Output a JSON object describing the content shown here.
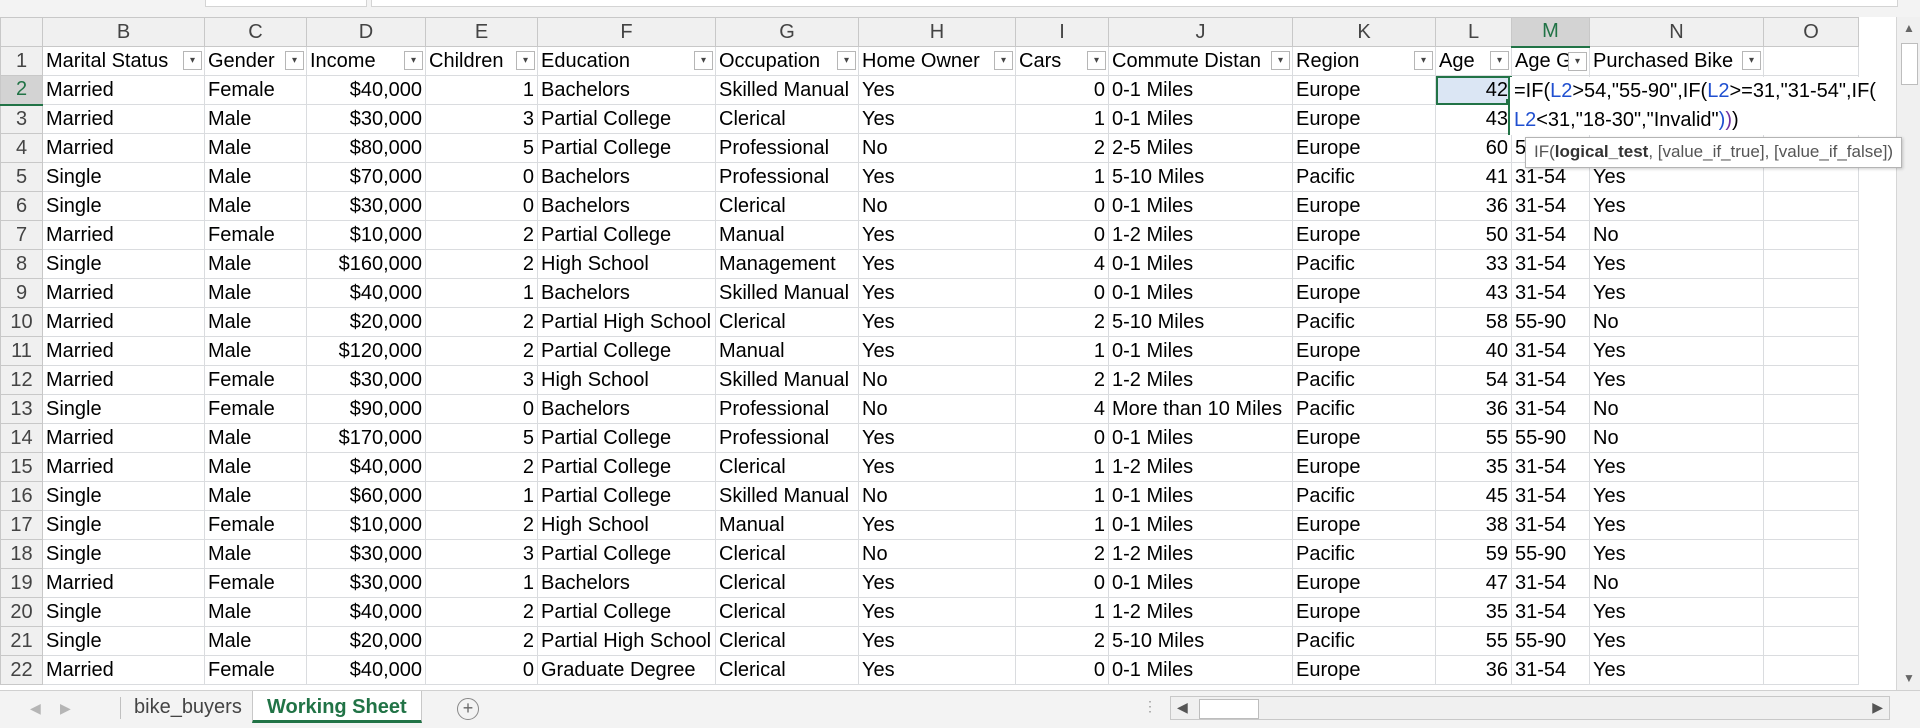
{
  "sheet": {
    "column_letters": [
      "B",
      "C",
      "D",
      "E",
      "F",
      "G",
      "H",
      "I",
      "J",
      "K",
      "L",
      "M",
      "N",
      "O"
    ],
    "headers": [
      "Marital Status",
      "Gender",
      "Income",
      "Children",
      "Education",
      "Occupation",
      "Home Owner",
      "Cars",
      "Commute Distan",
      "Region",
      "Age",
      "Age G",
      "Purchased Bike",
      ""
    ],
    "rows": [
      {
        "n": "1"
      },
      {
        "n": "2",
        "c": [
          "Married",
          "Female",
          "$40,000",
          "1",
          "Bachelors",
          "Skilled Manual",
          "Yes",
          "0",
          "0-1 Miles",
          "Europe",
          "42",
          "",
          ""
        ]
      },
      {
        "n": "3",
        "c": [
          "Married",
          "Male",
          "$30,000",
          "3",
          "Partial College",
          "Clerical",
          "Yes",
          "1",
          "0-1 Miles",
          "Europe",
          "43",
          "",
          ""
        ]
      },
      {
        "n": "4",
        "c": [
          "Married",
          "Male",
          "$80,000",
          "5",
          "Partial College",
          "Professional",
          "No",
          "2",
          "2-5 Miles",
          "Europe",
          "60",
          "5",
          ""
        ]
      },
      {
        "n": "5",
        "c": [
          "Single",
          "Male",
          "$70,000",
          "0",
          "Bachelors",
          "Professional",
          "Yes",
          "1",
          "5-10 Miles",
          "Pacific",
          "41",
          "31-54",
          "Yes"
        ]
      },
      {
        "n": "6",
        "c": [
          "Single",
          "Male",
          "$30,000",
          "0",
          "Bachelors",
          "Clerical",
          "No",
          "0",
          "0-1 Miles",
          "Europe",
          "36",
          "31-54",
          "Yes"
        ]
      },
      {
        "n": "7",
        "c": [
          "Married",
          "Female",
          "$10,000",
          "2",
          "Partial College",
          "Manual",
          "Yes",
          "0",
          "1-2 Miles",
          "Europe",
          "50",
          "31-54",
          "No"
        ]
      },
      {
        "n": "8",
        "c": [
          "Single",
          "Male",
          "$160,000",
          "2",
          "High School",
          "Management",
          "Yes",
          "4",
          "0-1 Miles",
          "Pacific",
          "33",
          "31-54",
          "Yes"
        ]
      },
      {
        "n": "9",
        "c": [
          "Married",
          "Male",
          "$40,000",
          "1",
          "Bachelors",
          "Skilled Manual",
          "Yes",
          "0",
          "0-1 Miles",
          "Europe",
          "43",
          "31-54",
          "Yes"
        ]
      },
      {
        "n": "10",
        "c": [
          "Married",
          "Male",
          "$20,000",
          "2",
          "Partial High School",
          "Clerical",
          "Yes",
          "2",
          "5-10 Miles",
          "Pacific",
          "58",
          "55-90",
          "No"
        ]
      },
      {
        "n": "11",
        "c": [
          "Married",
          "Male",
          "$120,000",
          "2",
          "Partial College",
          "Manual",
          "Yes",
          "1",
          "0-1 Miles",
          "Europe",
          "40",
          "31-54",
          "Yes"
        ]
      },
      {
        "n": "12",
        "c": [
          "Married",
          "Female",
          "$30,000",
          "3",
          "High School",
          "Skilled Manual",
          "No",
          "2",
          "1-2 Miles",
          "Pacific",
          "54",
          "31-54",
          "Yes"
        ]
      },
      {
        "n": "13",
        "c": [
          "Single",
          "Female",
          "$90,000",
          "0",
          "Bachelors",
          "Professional",
          "No",
          "4",
          "More than 10 Miles",
          "Pacific",
          "36",
          "31-54",
          "No"
        ]
      },
      {
        "n": "14",
        "c": [
          "Married",
          "Male",
          "$170,000",
          "5",
          "Partial College",
          "Professional",
          "Yes",
          "0",
          "0-1 Miles",
          "Europe",
          "55",
          "55-90",
          "No"
        ]
      },
      {
        "n": "15",
        "c": [
          "Married",
          "Male",
          "$40,000",
          "2",
          "Partial College",
          "Clerical",
          "Yes",
          "1",
          "1-2 Miles",
          "Europe",
          "35",
          "31-54",
          "Yes"
        ]
      },
      {
        "n": "16",
        "c": [
          "Single",
          "Male",
          "$60,000",
          "1",
          "Partial College",
          "Skilled Manual",
          "No",
          "1",
          "0-1 Miles",
          "Pacific",
          "45",
          "31-54",
          "Yes"
        ]
      },
      {
        "n": "17",
        "c": [
          "Single",
          "Female",
          "$10,000",
          "2",
          "High School",
          "Manual",
          "Yes",
          "1",
          "0-1 Miles",
          "Europe",
          "38",
          "31-54",
          "Yes"
        ]
      },
      {
        "n": "18",
        "c": [
          "Single",
          "Male",
          "$30,000",
          "3",
          "Partial College",
          "Clerical",
          "No",
          "2",
          "1-2 Miles",
          "Pacific",
          "59",
          "55-90",
          "Yes"
        ]
      },
      {
        "n": "19",
        "c": [
          "Married",
          "Female",
          "$30,000",
          "1",
          "Bachelors",
          "Clerical",
          "Yes",
          "0",
          "0-1 Miles",
          "Europe",
          "47",
          "31-54",
          "No"
        ]
      },
      {
        "n": "20",
        "c": [
          "Single",
          "Male",
          "$40,000",
          "2",
          "Partial College",
          "Clerical",
          "Yes",
          "1",
          "1-2 Miles",
          "Europe",
          "35",
          "31-54",
          "Yes"
        ]
      },
      {
        "n": "21",
        "c": [
          "Single",
          "Male",
          "$20,000",
          "2",
          "Partial High School",
          "Clerical",
          "Yes",
          "2",
          "5-10 Miles",
          "Pacific",
          "55",
          "55-90",
          "Yes"
        ]
      },
      {
        "n": "22",
        "c": [
          "Married",
          "Female",
          "$40,000",
          "0",
          "Graduate Degree",
          "Clerical",
          "Yes",
          "0",
          "0-1 Miles",
          "Europe",
          "36",
          "31-54",
          "Yes"
        ]
      }
    ]
  },
  "formula": {
    "line1": [
      {
        "t": "=IF(",
        "c": "plain"
      },
      {
        "t": "L2",
        "c": "ref"
      },
      {
        "t": ">54,\"55-90\",IF(",
        "c": "plain"
      },
      {
        "t": "L2",
        "c": "ref"
      },
      {
        "t": ">=31,\"31-54\",IF(",
        "c": "plain"
      }
    ],
    "line2": [
      {
        "t": "L2",
        "c": "ref"
      },
      {
        "t": "<31,\"18-30\",\"Invalid\"",
        "c": "plain"
      },
      {
        "t": ")",
        "c": "par2"
      },
      {
        "t": ")",
        "c": "par1"
      },
      {
        "t": ")",
        "c": "plain"
      }
    ]
  },
  "tooltip": {
    "fn": "IF(",
    "arg1": "logical_test",
    "rest": ", [value_if_true], [value_if_false])"
  },
  "tabs": {
    "sheets": [
      "bike_buyers",
      "Working Sheet"
    ],
    "active": "Working Sheet",
    "add_symbol": "+"
  },
  "colors": {
    "accent": "#217346",
    "selection": "#dbe6f4",
    "ref": "#1f4fd0"
  }
}
